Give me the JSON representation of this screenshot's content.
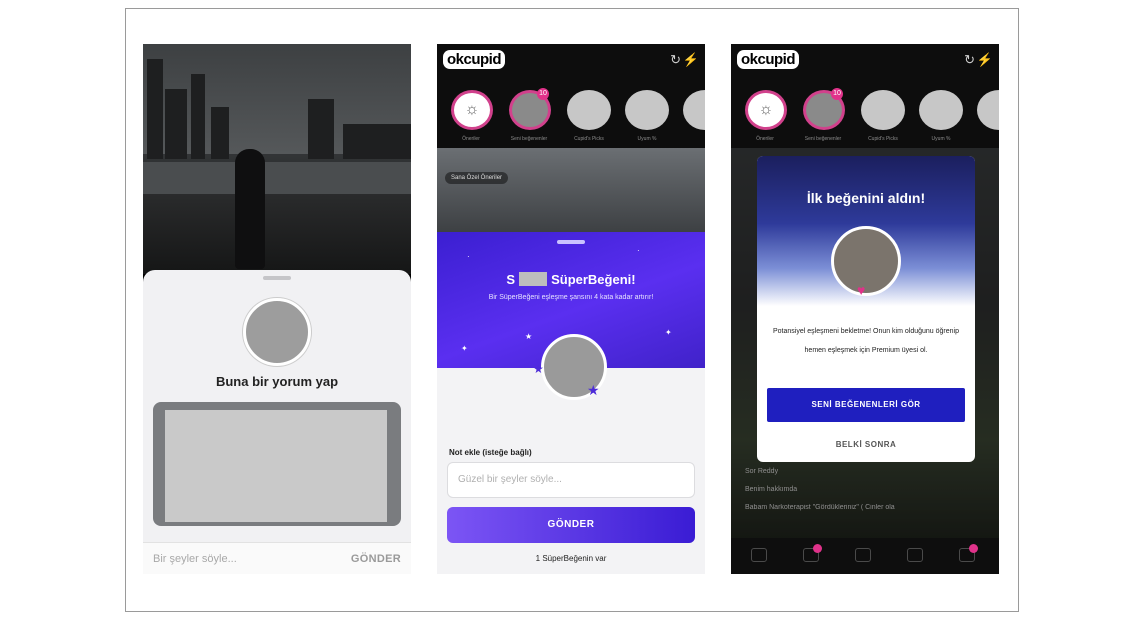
{
  "screen1": {
    "title": "Buna bir yorum yap",
    "input_placeholder": "Bir şeyler söyle...",
    "send_label": "GÖNDER"
  },
  "screen2": {
    "logo": "okcupid",
    "stories": [
      "Öneriler",
      "Seni beğenenler",
      "Cupid's Picks",
      "Uyum %"
    ],
    "story_badge": "10",
    "pill": "Sana Özel Öneriler",
    "title_left": "S",
    "title_right": "SüperBeğeni!",
    "subtitle": "Bir SüperBeğeni eşleşme şansını 4 kata kadar artırır!",
    "note_label": "Not ekle (isteğe bağlı)",
    "note_placeholder": "Güzel bir şeyler söyle...",
    "send_label": "GÖNDER",
    "count_text": "1 SüperBeğenin var"
  },
  "screen3": {
    "logo": "okcupid",
    "stories": [
      "Öneriler",
      "Seni beğenenler",
      "Cupid's Picks",
      "Uyum %"
    ],
    "story_badge": "10",
    "modal_title": "İlk beğenini aldın!",
    "modal_body": "Potansiyel eşleşmeni bekletme! Onun kim olduğunu öğrenip hemen eşleşmek için Premium üyesi ol.",
    "primary_button": "SENİ BEĞENENLERİ GÖR",
    "secondary_button": "BELKİ SONRA",
    "background_lines": [
      "Sor Reddy",
      "Benim hakkımda",
      "Babam Narkoterapist \"Gördükleriniz\" ( Cinler ola"
    ]
  },
  "colors": {
    "purple": "#5a2ff0",
    "blue_button": "#1f1fbf",
    "pink": "#e0328a"
  }
}
